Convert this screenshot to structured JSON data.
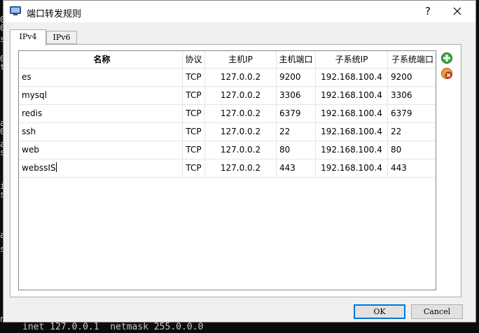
{
  "window": {
    "title": "端口转发规则",
    "help_label": "?"
  },
  "tabs": [
    {
      "label": "IPv4",
      "selected": true
    },
    {
      "label": "IPv6",
      "selected": false
    }
  ],
  "table": {
    "headers": {
      "name": "名称",
      "protocol": "协议",
      "host_ip": "主机IP",
      "host_port": "主机端口",
      "guest_ip": "子系统IP",
      "guest_port": "子系统端口"
    },
    "rows": [
      {
        "name": "es",
        "protocol": "TCP",
        "host_ip": "127.0.0.2",
        "host_port": "9200",
        "guest_ip": "192.168.100.4",
        "guest_port": "9200"
      },
      {
        "name": "mysql",
        "protocol": "TCP",
        "host_ip": "127.0.0.2",
        "host_port": "3306",
        "guest_ip": "192.168.100.4",
        "guest_port": "3306"
      },
      {
        "name": "redis",
        "protocol": "TCP",
        "host_ip": "127.0.0.2",
        "host_port": "6379",
        "guest_ip": "192.168.100.4",
        "guest_port": "6379"
      },
      {
        "name": "ssh",
        "protocol": "TCP",
        "host_ip": "127.0.0.2",
        "host_port": "22",
        "guest_ip": "192.168.100.4",
        "guest_port": "22"
      },
      {
        "name": "web",
        "protocol": "TCP",
        "host_ip": "127.0.0.2",
        "host_port": "80",
        "guest_ip": "192.168.100.4",
        "guest_port": "80"
      },
      {
        "name": "webssIS",
        "protocol": "TCP",
        "host_ip": "127.0.0.2",
        "host_port": "443",
        "guest_ip": "192.168.100.4",
        "guest_port": "443"
      }
    ]
  },
  "buttons": {
    "ok": "OK",
    "cancel": "Cancel"
  },
  "icons": {
    "add": "add-rule-icon",
    "remove": "remove-rule-icon",
    "app": "virtualbox-icon",
    "close": "close-icon"
  },
  "colors": {
    "ok_border": "#0078d7",
    "add_green": "#3ea83e",
    "remove_red": "#d9453b"
  },
  "background_terminal": {
    "left_fragments": [
      "0",
      "0",
      "s",
      "0",
      "t",
      "",
      "a",
      "0",
      "a",
      "s",
      "i",
      "s",
      "",
      "",
      "a",
      "s",
      "n"
    ],
    "bottom_line": "inet 127.0.0.1  netmask 255.0.0.0"
  }
}
